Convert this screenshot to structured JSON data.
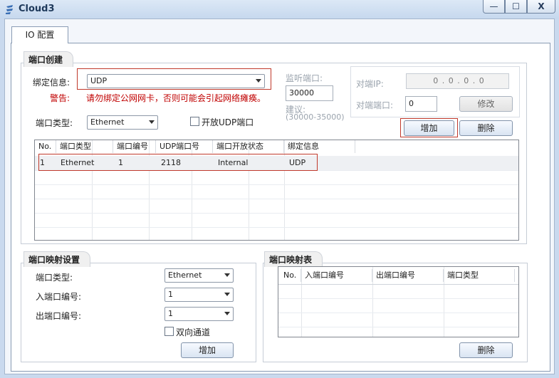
{
  "window": {
    "title": "Cloud3",
    "min": "—",
    "max": "☐",
    "close": "X"
  },
  "tab": {
    "label": "IO 配置"
  },
  "port_create": {
    "title": "端口创建",
    "bind_label": "绑定信息:",
    "bind_value": "UDP",
    "warning_label": "警告:",
    "warning_text": "请勿绑定公网网卡，否则可能会引起网络瘫痪。",
    "port_type_label": "端口类型:",
    "port_type_value": "Ethernet",
    "open_udp_label": "开放UDP端口",
    "listen_label": "监听端口:",
    "listen_value": "30000",
    "suggest_label": "建议:",
    "suggest_range": "(30000-35000)",
    "peer_ip_label": "对端IP:",
    "peer_ip_value": "0 . 0 . 0 . 0",
    "peer_port_label": "对端端口:",
    "peer_port_value": "0",
    "modify_label": "修改",
    "add_label": "增加",
    "delete_label": "删除"
  },
  "port_table": {
    "headers": [
      "No.",
      "端口类型",
      "端口编号",
      "UDP端口号",
      "端口开放状态",
      "绑定信息"
    ],
    "rows": [
      [
        "1",
        "Ethernet",
        "1",
        "2118",
        "Internal",
        "UDP"
      ]
    ]
  },
  "mapping_settings": {
    "title": "端口映射设置",
    "type_label": "端口类型:",
    "type_value": "Ethernet",
    "in_label": "入端口编号:",
    "in_value": "1",
    "out_label": "出端口编号:",
    "out_value": "1",
    "bidirectional_label": "双向通道",
    "add_label": "增加"
  },
  "mapping_table": {
    "title": "端口映射表",
    "headers": [
      "No.",
      "入端口编号",
      "出端口编号",
      "端口类型"
    ],
    "delete_label": "删除"
  },
  "colors": {
    "highlight": "#c0392b",
    "warning": "#c00000",
    "title_text": "#1e395b"
  }
}
